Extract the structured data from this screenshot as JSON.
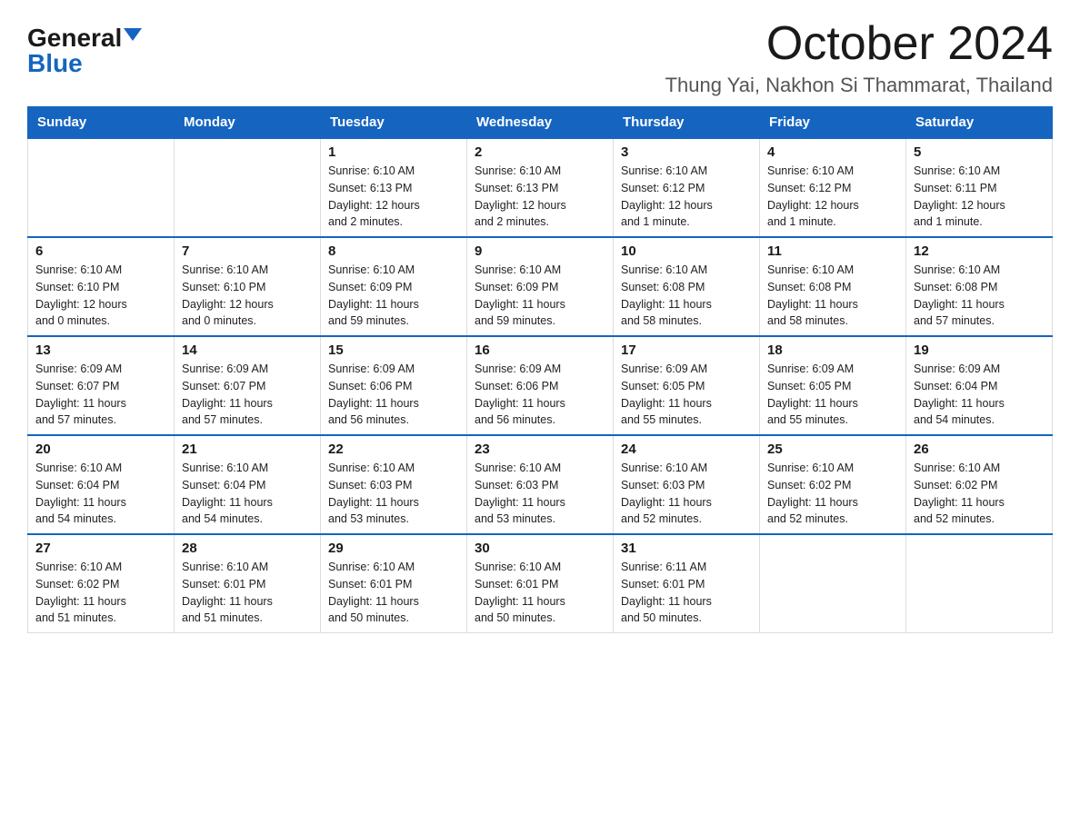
{
  "logo": {
    "general": "General",
    "blue": "Blue"
  },
  "title": {
    "month": "October 2024",
    "location": "Thung Yai, Nakhon Si Thammarat, Thailand"
  },
  "header_days": [
    "Sunday",
    "Monday",
    "Tuesday",
    "Wednesday",
    "Thursday",
    "Friday",
    "Saturday"
  ],
  "weeks": [
    [
      {
        "day": "",
        "info": ""
      },
      {
        "day": "",
        "info": ""
      },
      {
        "day": "1",
        "info": "Sunrise: 6:10 AM\nSunset: 6:13 PM\nDaylight: 12 hours\nand 2 minutes."
      },
      {
        "day": "2",
        "info": "Sunrise: 6:10 AM\nSunset: 6:13 PM\nDaylight: 12 hours\nand 2 minutes."
      },
      {
        "day": "3",
        "info": "Sunrise: 6:10 AM\nSunset: 6:12 PM\nDaylight: 12 hours\nand 1 minute."
      },
      {
        "day": "4",
        "info": "Sunrise: 6:10 AM\nSunset: 6:12 PM\nDaylight: 12 hours\nand 1 minute."
      },
      {
        "day": "5",
        "info": "Sunrise: 6:10 AM\nSunset: 6:11 PM\nDaylight: 12 hours\nand 1 minute."
      }
    ],
    [
      {
        "day": "6",
        "info": "Sunrise: 6:10 AM\nSunset: 6:10 PM\nDaylight: 12 hours\nand 0 minutes."
      },
      {
        "day": "7",
        "info": "Sunrise: 6:10 AM\nSunset: 6:10 PM\nDaylight: 12 hours\nand 0 minutes."
      },
      {
        "day": "8",
        "info": "Sunrise: 6:10 AM\nSunset: 6:09 PM\nDaylight: 11 hours\nand 59 minutes."
      },
      {
        "day": "9",
        "info": "Sunrise: 6:10 AM\nSunset: 6:09 PM\nDaylight: 11 hours\nand 59 minutes."
      },
      {
        "day": "10",
        "info": "Sunrise: 6:10 AM\nSunset: 6:08 PM\nDaylight: 11 hours\nand 58 minutes."
      },
      {
        "day": "11",
        "info": "Sunrise: 6:10 AM\nSunset: 6:08 PM\nDaylight: 11 hours\nand 58 minutes."
      },
      {
        "day": "12",
        "info": "Sunrise: 6:10 AM\nSunset: 6:08 PM\nDaylight: 11 hours\nand 57 minutes."
      }
    ],
    [
      {
        "day": "13",
        "info": "Sunrise: 6:09 AM\nSunset: 6:07 PM\nDaylight: 11 hours\nand 57 minutes."
      },
      {
        "day": "14",
        "info": "Sunrise: 6:09 AM\nSunset: 6:07 PM\nDaylight: 11 hours\nand 57 minutes."
      },
      {
        "day": "15",
        "info": "Sunrise: 6:09 AM\nSunset: 6:06 PM\nDaylight: 11 hours\nand 56 minutes."
      },
      {
        "day": "16",
        "info": "Sunrise: 6:09 AM\nSunset: 6:06 PM\nDaylight: 11 hours\nand 56 minutes."
      },
      {
        "day": "17",
        "info": "Sunrise: 6:09 AM\nSunset: 6:05 PM\nDaylight: 11 hours\nand 55 minutes."
      },
      {
        "day": "18",
        "info": "Sunrise: 6:09 AM\nSunset: 6:05 PM\nDaylight: 11 hours\nand 55 minutes."
      },
      {
        "day": "19",
        "info": "Sunrise: 6:09 AM\nSunset: 6:04 PM\nDaylight: 11 hours\nand 54 minutes."
      }
    ],
    [
      {
        "day": "20",
        "info": "Sunrise: 6:10 AM\nSunset: 6:04 PM\nDaylight: 11 hours\nand 54 minutes."
      },
      {
        "day": "21",
        "info": "Sunrise: 6:10 AM\nSunset: 6:04 PM\nDaylight: 11 hours\nand 54 minutes."
      },
      {
        "day": "22",
        "info": "Sunrise: 6:10 AM\nSunset: 6:03 PM\nDaylight: 11 hours\nand 53 minutes."
      },
      {
        "day": "23",
        "info": "Sunrise: 6:10 AM\nSunset: 6:03 PM\nDaylight: 11 hours\nand 53 minutes."
      },
      {
        "day": "24",
        "info": "Sunrise: 6:10 AM\nSunset: 6:03 PM\nDaylight: 11 hours\nand 52 minutes."
      },
      {
        "day": "25",
        "info": "Sunrise: 6:10 AM\nSunset: 6:02 PM\nDaylight: 11 hours\nand 52 minutes."
      },
      {
        "day": "26",
        "info": "Sunrise: 6:10 AM\nSunset: 6:02 PM\nDaylight: 11 hours\nand 52 minutes."
      }
    ],
    [
      {
        "day": "27",
        "info": "Sunrise: 6:10 AM\nSunset: 6:02 PM\nDaylight: 11 hours\nand 51 minutes."
      },
      {
        "day": "28",
        "info": "Sunrise: 6:10 AM\nSunset: 6:01 PM\nDaylight: 11 hours\nand 51 minutes."
      },
      {
        "day": "29",
        "info": "Sunrise: 6:10 AM\nSunset: 6:01 PM\nDaylight: 11 hours\nand 50 minutes."
      },
      {
        "day": "30",
        "info": "Sunrise: 6:10 AM\nSunset: 6:01 PM\nDaylight: 11 hours\nand 50 minutes."
      },
      {
        "day": "31",
        "info": "Sunrise: 6:11 AM\nSunset: 6:01 PM\nDaylight: 11 hours\nand 50 minutes."
      },
      {
        "day": "",
        "info": ""
      },
      {
        "day": "",
        "info": ""
      }
    ]
  ]
}
